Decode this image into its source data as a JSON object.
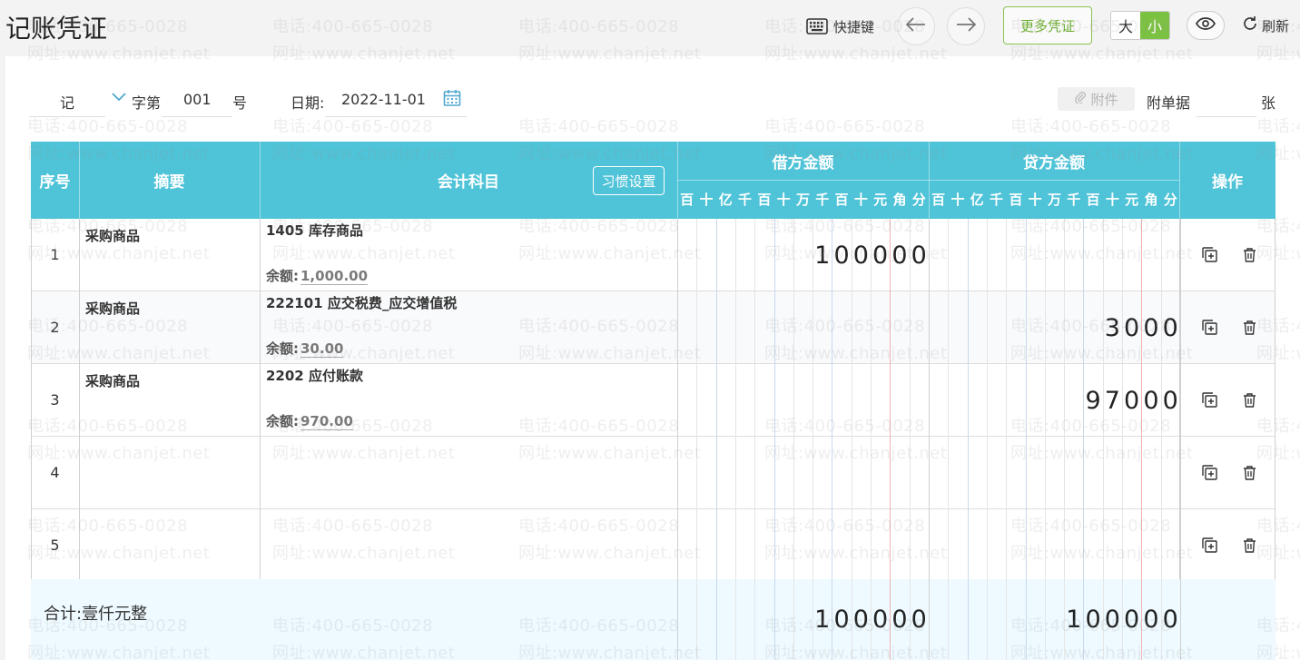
{
  "title": "记账凭证",
  "header": {
    "shortcut_label": "快捷键",
    "more_label": "更多凭证",
    "size_large": "大",
    "size_small": "小",
    "refresh_label": "刷新"
  },
  "meta": {
    "voucher_type": "记",
    "word_label": "字第",
    "number": "001",
    "number_suffix": "号",
    "date_label": "日期:",
    "date": "2022-11-01",
    "attach_label": "附件",
    "doc_label": "附单据",
    "doc_count": "",
    "doc_unit": "张"
  },
  "table": {
    "col_no": "序号",
    "col_summary": "摘要",
    "col_account": "会计科目",
    "habit_label": "习惯设置",
    "col_debit": "借方金额",
    "col_credit": "贷方金额",
    "col_ops": "操作",
    "units": [
      "百",
      "十",
      "亿",
      "千",
      "百",
      "十",
      "万",
      "千",
      "百",
      "十",
      "元",
      "角",
      "分"
    ]
  },
  "rows": [
    {
      "no": "1",
      "summary": "采购商品",
      "account": "1405 库存商品",
      "balance_label": "余额:",
      "balance": "1,000.00",
      "debit": "100000",
      "credit": ""
    },
    {
      "no": "2",
      "summary": "采购商品",
      "account": "222101 应交税费_应交增值税",
      "balance_label": "余额:",
      "balance": "30.00",
      "debit": "",
      "credit": "3000"
    },
    {
      "no": "3",
      "summary": "采购商品",
      "account": "2202 应付账款",
      "balance_label": "余额:",
      "balance": "970.00",
      "debit": "",
      "credit": "97000"
    },
    {
      "no": "4",
      "summary": "",
      "account": "",
      "balance_label": "",
      "balance": "",
      "debit": "",
      "credit": ""
    },
    {
      "no": "5",
      "summary": "",
      "account": "",
      "balance_label": "",
      "balance": "",
      "debit": "",
      "credit": ""
    }
  ],
  "total": {
    "label": "合计:壹仟元整",
    "debit": "100000",
    "credit": "100000"
  },
  "watermark": {
    "line1": "电话:400-665-0028",
    "line2": "网址:www.chanjet.net"
  },
  "colors": {
    "header_bg": "#4fc3d7",
    "accent_green": "#7cc242"
  }
}
